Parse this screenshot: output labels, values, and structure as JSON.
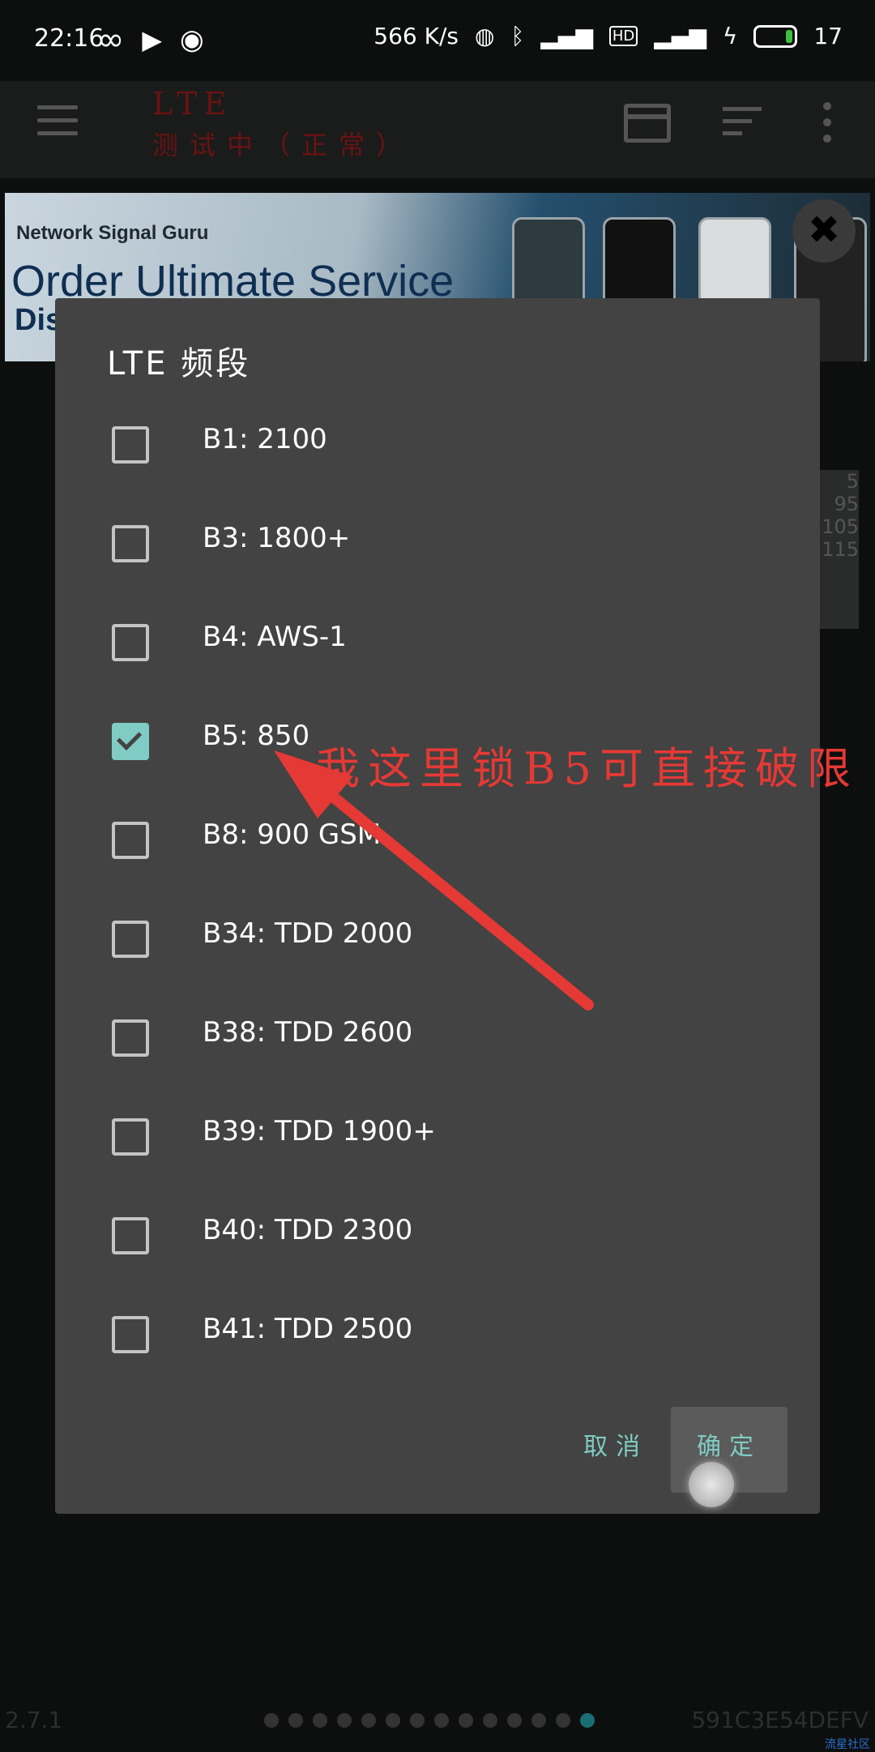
{
  "status_bar": {
    "time": "22:16",
    "net_speed": "566 K/s",
    "battery_level": "17"
  },
  "app_bar": {
    "title": "LTE",
    "subtitle": "测试中（正常）"
  },
  "banner": {
    "brand": "Network Signal Guru",
    "headline": "Order Ultimate Service",
    "headline_cut": "Dis"
  },
  "background_values": [
    "5",
    "95",
    "105",
    "115"
  ],
  "dialog": {
    "title": "LTE 频段",
    "options": [
      {
        "label": "B1: 2100",
        "checked": false
      },
      {
        "label": "B3: 1800+",
        "checked": false
      },
      {
        "label": "B4: AWS-1",
        "checked": false
      },
      {
        "label": "B5: 850",
        "checked": true
      },
      {
        "label": "B8: 900 GSM",
        "checked": false
      },
      {
        "label": "B34: TDD 2000",
        "checked": false
      },
      {
        "label": "B38: TDD 2600",
        "checked": false
      },
      {
        "label": "B39: TDD 1900+",
        "checked": false
      },
      {
        "label": "B40: TDD 2300",
        "checked": false
      },
      {
        "label": "B41: TDD 2500",
        "checked": false
      }
    ],
    "cancel_label": "取消",
    "ok_label": "确定"
  },
  "annotation": "我这里锁B5可直接破限",
  "bottom_bar": {
    "version": "2.7.1",
    "page_count": 14,
    "active_page": 14,
    "device_id": "591C3E54DEFV",
    "watermark": "流星社区"
  },
  "colors": {
    "accent": "#80cbc4",
    "annotation": "#e53935",
    "dialog_bg": "#424342"
  }
}
